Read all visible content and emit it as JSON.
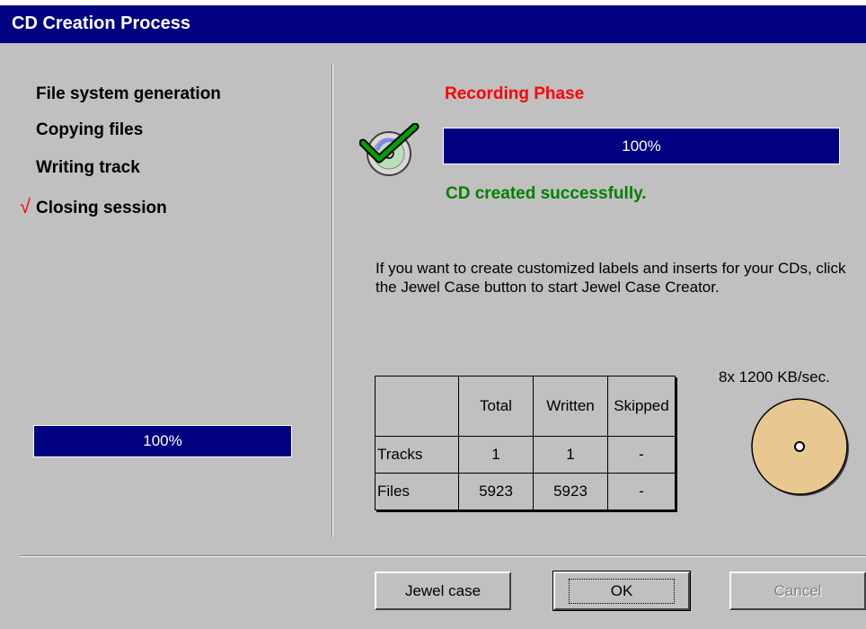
{
  "window": {
    "title": "CD Creation Process"
  },
  "steps": [
    {
      "label": "File system generation",
      "done": false
    },
    {
      "label": "Copying files",
      "done": false
    },
    {
      "label": "Writing track",
      "done": false
    },
    {
      "label": "Closing session",
      "done": true
    }
  ],
  "step_check_glyph": "√",
  "overall_progress": {
    "value": 100,
    "label": "100%"
  },
  "phase": {
    "title": "Recording Phase",
    "progress": 100,
    "progress_label": "100%",
    "status": "CD created successfully."
  },
  "info_text": "If you want to create customized labels and inserts for your CDs, click the Jewel Case button to start Jewel Case Creator.",
  "stats_table": {
    "headers": [
      "",
      "Total",
      "Written",
      "Skipped"
    ],
    "rows": [
      [
        "Tracks",
        "1",
        "1",
        "-"
      ],
      [
        "Files",
        "5923",
        "5923",
        "-"
      ]
    ]
  },
  "speed": "8x 1200 KB/sec.",
  "buttons": {
    "jewel_case": "Jewel case",
    "ok": "OK",
    "cancel": "Cancel"
  },
  "icons": {
    "cd_success": "cd-check-icon",
    "disc": "disc-icon"
  },
  "colors": {
    "titlebar": "#000080",
    "phase": "#ff0000",
    "success": "#008000",
    "disc": "#e8c890"
  }
}
